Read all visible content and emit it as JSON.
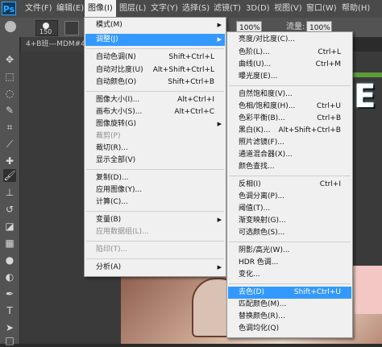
{
  "menubar": {
    "logo": "Ps",
    "items": [
      "文件(F)",
      "编辑(E)",
      "图像(I)",
      "图层(L)",
      "文字(Y)",
      "选择(S)",
      "滤镜(T)",
      "3D(D)",
      "视图(V)",
      "窗口(W)",
      "帮助(H)"
    ]
  },
  "options": {
    "brush_size": "150",
    "opacity": "100%",
    "flow_label": "流量:",
    "flow": "100%"
  },
  "document_tab": "4+B班---MDM#4",
  "image_menu": {
    "items": [
      {
        "label": "模式(M)",
        "shortcut": "",
        "submenu": true,
        "disabled": false
      },
      {
        "label": "调整(J)",
        "shortcut": "",
        "submenu": true,
        "disabled": false
      },
      {
        "label": "自动色调(N)",
        "shortcut": "Shift+Ctrl+L",
        "submenu": false,
        "disabled": false
      },
      {
        "label": "自动对比度(U)",
        "shortcut": "Alt+Shift+Ctrl+L",
        "submenu": false,
        "disabled": false
      },
      {
        "label": "自动颜色(O)",
        "shortcut": "Shift+Ctrl+B",
        "submenu": false,
        "disabled": false
      },
      {
        "label": "图像大小(I)...",
        "shortcut": "Alt+Ctrl+I",
        "submenu": false,
        "disabled": false
      },
      {
        "label": "画布大小(S)...",
        "shortcut": "Alt+Ctrl+C",
        "submenu": false,
        "disabled": false
      },
      {
        "label": "图像旋转(G)",
        "shortcut": "",
        "submenu": true,
        "disabled": false
      },
      {
        "label": "裁剪(P)",
        "shortcut": "",
        "submenu": false,
        "disabled": true
      },
      {
        "label": "裁切(R)...",
        "shortcut": "",
        "submenu": false,
        "disabled": false
      },
      {
        "label": "显示全部(V)",
        "shortcut": "",
        "submenu": false,
        "disabled": false
      },
      {
        "label": "复制(D)...",
        "shortcut": "",
        "submenu": false,
        "disabled": false
      },
      {
        "label": "应用图像(Y)...",
        "shortcut": "",
        "submenu": false,
        "disabled": false
      },
      {
        "label": "计算(C)...",
        "shortcut": "",
        "submenu": false,
        "disabled": false
      },
      {
        "label": "变量(B)",
        "shortcut": "",
        "submenu": true,
        "disabled": false
      },
      {
        "label": "应用数据组(L)...",
        "shortcut": "",
        "submenu": false,
        "disabled": true
      },
      {
        "label": "陷印(T)...",
        "shortcut": "",
        "submenu": false,
        "disabled": true
      },
      {
        "label": "分析(A)",
        "shortcut": "",
        "submenu": true,
        "disabled": false
      }
    ]
  },
  "adjust_menu": {
    "items": [
      {
        "label": "亮度/对比度(C)...",
        "shortcut": ""
      },
      {
        "label": "色阶(L)...",
        "shortcut": "Ctrl+L"
      },
      {
        "label": "曲线(U)...",
        "shortcut": "Ctrl+M"
      },
      {
        "label": "曝光度(E)...",
        "shortcut": ""
      },
      {
        "label": "自然饱和度(V)...",
        "shortcut": ""
      },
      {
        "label": "色相/饱和度(H)...",
        "shortcut": "Ctrl+U"
      },
      {
        "label": "色彩平衡(B)...",
        "shortcut": "Ctrl+B"
      },
      {
        "label": "黑白(K)...",
        "shortcut": "Alt+Shift+Ctrl+B"
      },
      {
        "label": "照片滤镜(F)...",
        "shortcut": ""
      },
      {
        "label": "通道混合器(X)...",
        "shortcut": ""
      },
      {
        "label": "颜色查找...",
        "shortcut": ""
      },
      {
        "label": "反相(I)",
        "shortcut": "Ctrl+I"
      },
      {
        "label": "色调分离(P)...",
        "shortcut": ""
      },
      {
        "label": "阈值(T)...",
        "shortcut": ""
      },
      {
        "label": "渐变映射(G)...",
        "shortcut": ""
      },
      {
        "label": "可选颜色(S)...",
        "shortcut": ""
      },
      {
        "label": "阴影/高光(W)...",
        "shortcut": ""
      },
      {
        "label": "HDR 色调...",
        "shortcut": ""
      },
      {
        "label": "变化...",
        "shortcut": ""
      },
      {
        "label": "去色(D)",
        "shortcut": "Shift+Ctrl+U"
      },
      {
        "label": "匹配颜色(M)...",
        "shortcut": ""
      },
      {
        "label": "替换颜色(R)...",
        "shortcut": ""
      },
      {
        "label": "色调均化(Q)",
        "shortcut": ""
      }
    ]
  },
  "tools": [
    "move-tool-icon",
    "marquee-tool-icon",
    "lasso-tool-icon",
    "quick-select-tool-icon",
    "crop-tool-icon",
    "eyedropper-tool-icon",
    "healing-brush-tool-icon",
    "brush-tool-icon",
    "clone-stamp-tool-icon",
    "history-brush-tool-icon",
    "eraser-tool-icon",
    "gradient-tool-icon",
    "blur-tool-icon",
    "dodge-tool-icon",
    "pen-tool-icon",
    "type-tool-icon",
    "path-select-tool-icon",
    "shape-tool-icon",
    "hand-tool-icon"
  ],
  "colors": {
    "highlight": "#3399ff",
    "menu_bg": "#f0f0f0",
    "menubar_bg": "#4a4a4a"
  }
}
